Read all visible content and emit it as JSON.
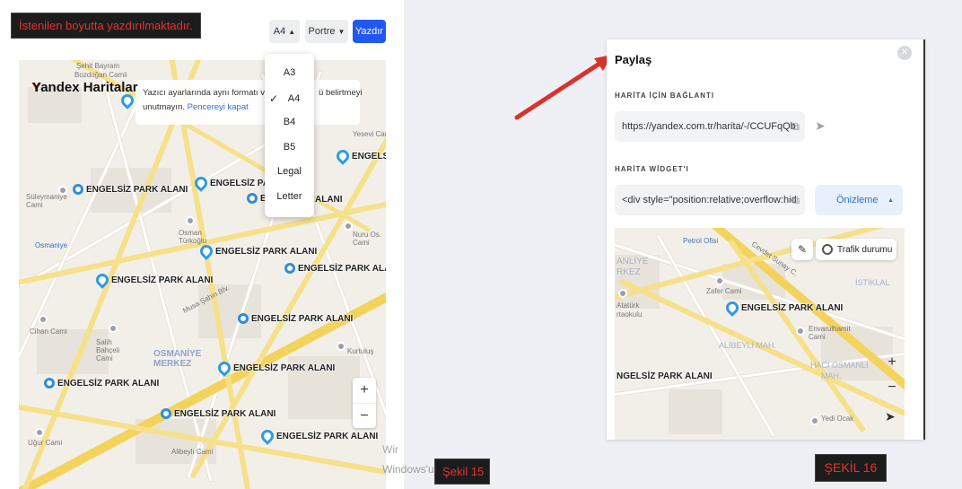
{
  "captions": {
    "top_left": "İstenilen boyutta yazdırılmaktadır.",
    "fig15": "Şekil 15",
    "fig16": "ŞEKİL 16"
  },
  "print_toolbar": {
    "paper_size": "A4",
    "orientation": "Portre",
    "print_button": "Yazdır"
  },
  "paper_menu": {
    "options": [
      "A3",
      "A4",
      "B4",
      "B5",
      "Legal",
      "Letter"
    ],
    "selected": "A4"
  },
  "left_map": {
    "logo": "Yandex Haritalar",
    "notice": "Yazıcı ayarlarında aynı formatı ve sa",
    "notice_tail": "ü belirtmeyi",
    "notice_line2": "unutmayın.",
    "close_link": "Pencereyi kapat",
    "pin_label": "ENGELSİZ PARK ALANI",
    "pin_label_cut": "ENGELSİ",
    "pin_label_cut2": "ALANI",
    "labels": {
      "sehit": "Şehit Bayram",
      "bozdogan": "Bozdoğan Camii",
      "suleymaniye": "Süleymaniye Cami",
      "osmaniye": "Osmaniye",
      "osman_turkoglu": "Osman Türkoğlu",
      "cihan": "Cihan Cami",
      "salih": "Salih Bahçeli Cami",
      "osmaniye_merkez": "OSMANİYE MERKEZ",
      "ugur": "Uğur Cami",
      "aliseyli": "Alibeyli Cami",
      "musa": "Musa Şahin Blv.",
      "nuru": "Nuru Os. Cami",
      "kurtulus": "Kurtuluş",
      "yesevi": "Yesevi Cam"
    },
    "zoom_in": "+",
    "zoom_out": "−"
  },
  "windows_watermark": "Windows'u",
  "windows_watermark_top": "Wir",
  "share_panel": {
    "title": "Paylaş",
    "link_section": "HARİTA İÇİN BAĞLANTI",
    "link_value": "https://yandex.com.tr/harita/-/CCUFqQb",
    "widget_section": "HARİTA WİDGET'I",
    "widget_value": "<div style=\"position:relative;overflow:hid",
    "preview_button": "Önizleme",
    "traffic_button": "Trafik durumu",
    "map": {
      "petrol": "Petrol Ofisi",
      "anliye": "ANLİYE",
      "erkez": "RKEZ",
      "zafer": "Zafer Cami",
      "ataturk": "Atatürk",
      "ortaokulu": "rtaokulu",
      "pin_label": "ENGELSİZ PARK ALANI",
      "pin_label_left": "NGELSİZ PARK ALANI",
      "alibeyli": "ALİBEYLİ MAH.",
      "haci": "HACI OSMANLI",
      "mah": "MAH.",
      "istiklal": "İSTİKLAL",
      "envarul": "Envarulhamit",
      "cami": "Cami",
      "yedi": "Yedi Ocak",
      "cevdet": "Cevdet Sunay C.",
      "zoom_in": "+",
      "zoom_out": "−"
    }
  },
  "colors": {
    "primary": "#2157f3",
    "arrow": "#d9342b",
    "caption_text": "#e2342b"
  }
}
